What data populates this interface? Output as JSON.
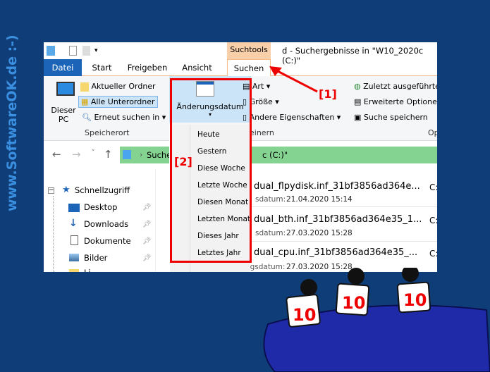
{
  "watermark_side": "www.SoftwareOK.de :-)",
  "window": {
    "title": "d - Suchergebnisse in \"W10_2020c (C:)\"",
    "context_tab": "Suchtools"
  },
  "tabs": [
    "Datei",
    "Start",
    "Freigeben",
    "Ansicht",
    "Suchen"
  ],
  "ribbon": {
    "dieser_pc": "Dieser PC",
    "aktueller_ordner": "Aktueller Ordner",
    "alle_unterordner": "Alle Unterordner",
    "erneut_suchen": "Erneut suchen in",
    "speicherort": "Speicherort",
    "aenderungsdatum": "Änderungsdatum",
    "art": "Art",
    "groesse": "Größe",
    "andere": "Andere Eigenschaften",
    "verfeinern": "einern",
    "zuletzt": "Zuletzt ausgeführte",
    "erweitert": "Erweiterte Optionen",
    "speichern": "Suche speichern",
    "optionen": "Op"
  },
  "address": {
    "text": "Suche",
    "tail": "c (C:)\""
  },
  "date_menu": [
    "Heute",
    "Gestern",
    "Diese Woche",
    "Letzte Woche",
    "Diesen Monat",
    "Letzten Monat",
    "Dieses Jahr",
    "Letztes Jahr"
  ],
  "nav_pane": {
    "quick": "Schnellzugriff",
    "items": [
      "Desktop",
      "Downloads",
      "Dokumente",
      "Bilder",
      "Li"
    ]
  },
  "results": [
    {
      "name": "dual_flpydisk.inf_31bf3856ad364e...",
      "date_label": "sdatum:",
      "date": "21.04.2020 15:14",
      "col": "C:"
    },
    {
      "name": "dual_bth.inf_31bf3856ad364e35_1...",
      "date_label": "sdatum:",
      "date": "27.03.2020 15:28",
      "col": "C:"
    },
    {
      "name": "dual_cpu.inf_31bf3856ad364e35_...",
      "date_label": "Änderungsdatum:",
      "date": "27.03.2020 15:28",
      "col": "C:"
    }
  ],
  "annotations": [
    "[1]",
    "[2]"
  ],
  "scores": [
    "10",
    "10",
    "10"
  ],
  "colors": {
    "background": "#0f3d78",
    "file_tab": "#1c64b8",
    "context": "#f9cfa9",
    "address": "#85d391",
    "highlight": "#e00000"
  }
}
